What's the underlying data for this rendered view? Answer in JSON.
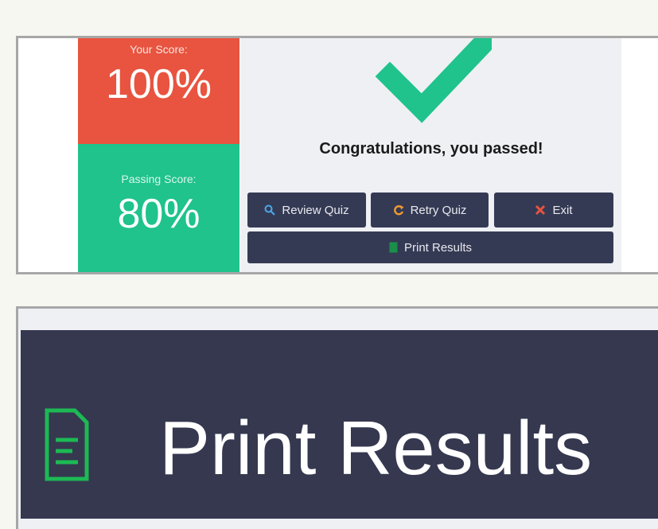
{
  "score": {
    "your_label": "Your Score:",
    "your_value": "100%",
    "passing_label": "Passing Score:",
    "passing_value": "80%"
  },
  "result": {
    "message": "Congratulations, you passed!",
    "status_icon": "checkmark-icon"
  },
  "buttons": {
    "review": {
      "label": "Review Quiz",
      "icon": "search-icon"
    },
    "retry": {
      "label": "Retry Quiz",
      "icon": "retry-icon"
    },
    "exit": {
      "label": "Exit",
      "icon": "close-icon"
    },
    "print": {
      "label": "Print Results",
      "icon": "document-icon"
    }
  },
  "zoom_button": {
    "label": "Print Results",
    "icon": "document-icon"
  },
  "colors": {
    "your_score_bg": "#e8543f",
    "passing_score_bg": "#1fc38b",
    "button_bg": "#353a54",
    "check": "#1fc38b",
    "document_icon": "#1db954"
  }
}
